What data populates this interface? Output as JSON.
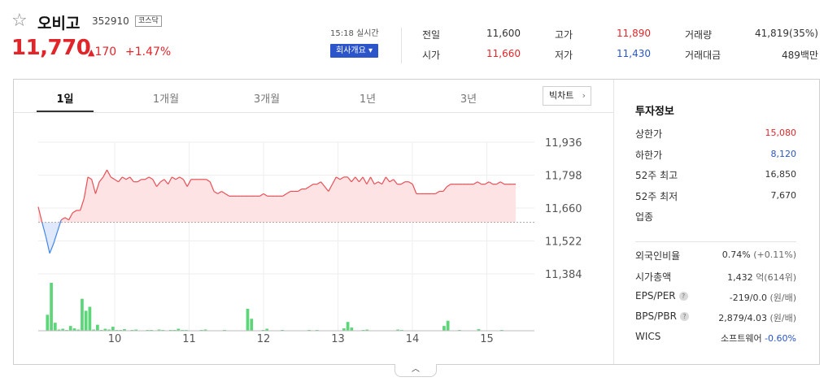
{
  "header": {
    "star_icon": "star-outline-icon",
    "name": "오비고",
    "code": "352910",
    "market": "코스닥",
    "price": "11,770",
    "change_arrow": "▲",
    "change": "170",
    "change_pct": "+1.47%",
    "realtime": "15:18 실시간",
    "company_btn": "회사개요 ▾"
  },
  "quotes": {
    "prev_label": "전일",
    "prev_value": "11,600",
    "open_label": "시가",
    "open_value": "11,660",
    "high_label": "고가",
    "high_value": "11,890",
    "low_label": "저가",
    "low_value": "11,430",
    "volume_label": "거래량",
    "volume_value": "41,819(35%)",
    "amount_label": "거래대금",
    "amount_value": "489백만"
  },
  "tabs": [
    "1일",
    "1개월",
    "3개월",
    "1년",
    "3년"
  ],
  "bigchart_label": "빅차트",
  "info": {
    "title": "투자정보",
    "upper_label": "상한가",
    "upper_value": "15,080",
    "lower_label": "하한가",
    "lower_value": "8,120",
    "high52_label": "52주 최고",
    "high52_value": "16,850",
    "low52_label": "52주 최저",
    "low52_value": "7,670",
    "sector_label": "업종",
    "foreign_label": "외국인비율",
    "foreign_value": "0.74%",
    "foreign_sub": "(+0.11%)",
    "mcap_label": "시가총액",
    "mcap_value": "1,432",
    "mcap_sub": "억(614위)",
    "eps_label": "EPS/PER",
    "eps_value": "-219/0.0",
    "eps_sub": "(원/배)",
    "bps_label": "BPS/PBR",
    "bps_value": "2,879/4.03",
    "bps_sub": "(원/배)",
    "wics_label": "WICS",
    "wics_value": "소프트웨어",
    "wics_change": "-0.60%"
  },
  "chart_data": {
    "type": "line",
    "title": "",
    "y_ticks": [
      "11,936",
      "11,798",
      "11,660",
      "11,522",
      "11,384"
    ],
    "x_ticks": [
      "10",
      "11",
      "12",
      "13",
      "14",
      "15"
    ],
    "ylim": [
      11384,
      11936
    ],
    "base": 11600,
    "price": [
      11665,
      11600,
      11540,
      11470,
      11510,
      11560,
      11610,
      11620,
      11610,
      11640,
      11650,
      11650,
      11700,
      11790,
      11780,
      11720,
      11770,
      11790,
      11820,
      11790,
      11780,
      11770,
      11790,
      11780,
      11790,
      11770,
      11770,
      11780,
      11780,
      11790,
      11780,
      11750,
      11770,
      11780,
      11760,
      11790,
      11780,
      11790,
      11780,
      11750,
      11780,
      11780,
      11780,
      11780,
      11780,
      11770,
      11730,
      11720,
      11730,
      11720,
      11710,
      11710,
      11710,
      11710,
      11710,
      11710,
      11710,
      11710,
      11710,
      11720,
      11710,
      11710,
      11710,
      11710,
      11710,
      11720,
      11730,
      11730,
      11730,
      11740,
      11740,
      11750,
      11760,
      11760,
      11770,
      11750,
      11730,
      11760,
      11790,
      11780,
      11790,
      11790,
      11770,
      11790,
      11770,
      11790,
      11760,
      11790,
      11760,
      11770,
      11760,
      11790,
      11770,
      11780,
      11760,
      11760,
      11770,
      11770,
      11760,
      11720,
      11720,
      11720,
      11720,
      11720,
      11720,
      11730,
      11730,
      11750,
      11760,
      11760,
      11760,
      11760,
      11760,
      11760,
      11760,
      11770,
      11760,
      11760,
      11770,
      11760,
      11760,
      11770,
      11760,
      11760,
      11760,
      11760
    ],
    "volume": [
      1,
      0,
      40,
      120,
      20,
      3,
      5,
      2,
      12,
      6,
      3,
      80,
      50,
      60,
      3,
      15,
      2,
      5,
      3,
      10,
      2,
      2,
      4,
      1,
      2,
      3,
      1,
      1,
      2,
      2,
      1,
      3,
      2,
      1,
      2,
      2,
      5,
      2,
      2,
      1,
      1,
      1,
      2,
      3,
      1,
      1,
      1,
      1,
      2,
      1,
      1,
      1,
      1,
      1,
      55,
      30,
      1,
      1,
      2,
      5,
      1,
      1,
      1,
      2,
      1,
      1,
      1,
      1,
      1,
      1,
      2,
      1,
      2,
      1,
      1,
      1,
      1,
      1,
      1,
      6,
      22,
      8,
      1,
      1,
      2,
      3,
      1,
      1,
      1,
      1,
      1,
      1,
      1,
      3,
      2,
      1,
      1,
      1,
      1,
      1,
      1,
      1,
      1,
      1,
      1,
      12,
      25,
      1,
      1,
      2,
      1,
      1,
      1,
      1,
      4,
      1,
      1,
      1,
      1,
      1,
      2,
      1,
      1,
      1
    ],
    "grid": true
  }
}
